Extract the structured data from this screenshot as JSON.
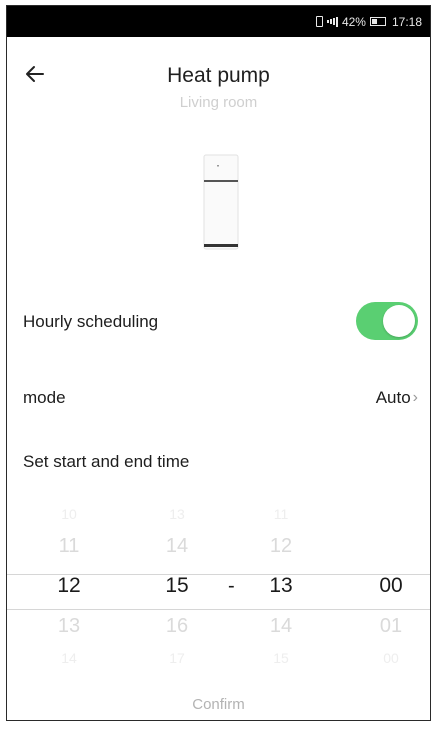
{
  "status_bar": {
    "battery": "42%",
    "time": "17:18"
  },
  "header": {
    "title": "Heat pump",
    "subtitle": "Living room"
  },
  "schedule": {
    "label": "Hourly scheduling",
    "enabled": true
  },
  "mode": {
    "label": "mode",
    "value": "Auto"
  },
  "time_section": {
    "label": "Set start and end time"
  },
  "picker": {
    "start_hour": {
      "above2": "10",
      "above1": "11",
      "selected": "12",
      "below1": "13",
      "below2": "14"
    },
    "start_minute": {
      "above2": "13",
      "above1": "14",
      "selected": "15",
      "below1": "16",
      "below2": "17"
    },
    "separator": "-",
    "end_hour": {
      "above2": "11",
      "above1": "12",
      "selected": "13",
      "below1": "14",
      "below2": "15"
    },
    "end_minute": {
      "above2": "",
      "above1": "",
      "selected": "00",
      "below1": "01",
      "below2": "00"
    }
  },
  "footer": {
    "confirm_label": "Confirm"
  },
  "colors": {
    "toggle_on": "#5acf72",
    "status_bar_bg": "#000000"
  }
}
